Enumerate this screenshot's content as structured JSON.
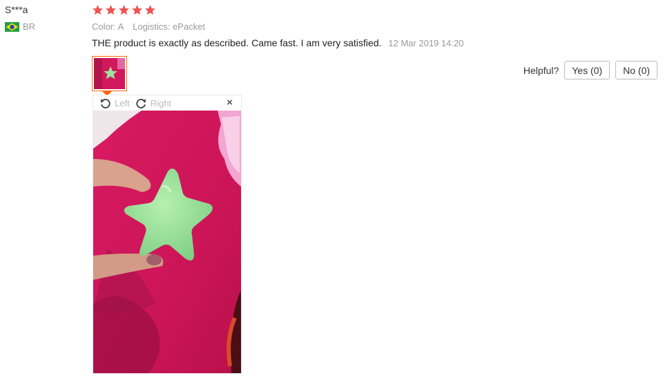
{
  "user": {
    "name": "S***a",
    "country_code": "BR",
    "flag_icon": "brazil-flag-icon"
  },
  "review": {
    "rating": 5,
    "star_color": "#ef5350",
    "color_label": "Color: A",
    "logistics_label": "Logistics: ePacket",
    "text": "THE product is exactly as described. Came fast. I am very satisfied.",
    "date": "12 Mar 2019 14:20"
  },
  "viewer": {
    "rotate_left_label": "Left",
    "rotate_right_label": "Right",
    "close_label": "×"
  },
  "helpful": {
    "label": "Helpful?",
    "yes_label": "Yes (0)",
    "no_label": "No (0)"
  },
  "colors": {
    "accent": "#ff6600"
  }
}
